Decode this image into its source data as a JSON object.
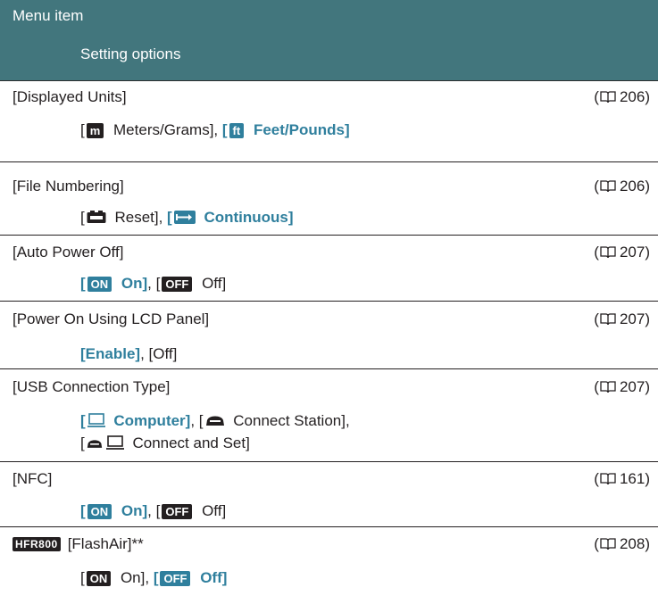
{
  "header": {
    "menu_item": "Menu item",
    "setting_options": "Setting options"
  },
  "rows": [
    {
      "name": "[Displayed Units]",
      "ref": "206",
      "opt_a_open": "[",
      "opt_a_badge": "m",
      "opt_a_text": " Meters/Grams], ",
      "opt_b_open": "[",
      "opt_b_badge": "ft",
      "opt_b_text": " Feet/Pounds]"
    },
    {
      "name": "[File Numbering]",
      "ref": "206",
      "opt_a_open": "[",
      "opt_a_text": " Reset], ",
      "opt_b_open": "[",
      "opt_b_text": " Continuous]"
    },
    {
      "name": "[Auto Power Off]",
      "ref": "207",
      "opt_a_open": "[",
      "opt_a_badge": "ON",
      "opt_a_text": " On]",
      "sep": ", ",
      "opt_b_open": "[",
      "opt_b_badge": "OFF",
      "opt_b_text": " Off]"
    },
    {
      "name": "[Power On Using LCD Panel]",
      "ref": "207",
      "opt_a": "[Enable]",
      "sep": ", ",
      "opt_b": "[Off]"
    },
    {
      "name": "[USB Connection Type]",
      "ref": "207",
      "opt_a_open": "[",
      "opt_a_text": " Computer]",
      "sep": ", ",
      "opt_b_open": "[",
      "opt_b_text": " Connect Station],",
      "opt_c_open": "[",
      "opt_c_text": " Connect and Set]"
    },
    {
      "name": "[NFC]",
      "ref": "161",
      "opt_a_open": "[",
      "opt_a_badge": "ON",
      "opt_a_text": " On]",
      "sep": ", ",
      "opt_b_open": "[",
      "opt_b_badge": "OFF",
      "opt_b_text": " Off]"
    },
    {
      "model_badge": "HFR800",
      "name": "[FlashAir]**",
      "ref": "208",
      "opt_a_open": "[",
      "opt_a_badge": "ON",
      "opt_a_text": " On], ",
      "opt_b_open": "[",
      "opt_b_badge": "OFF",
      "opt_b_text": " Off]"
    }
  ],
  "ref_open": "(",
  "ref_close": ")",
  "colors": {
    "header_bg": "#42767d",
    "highlight": "#2f7f9d",
    "text": "#231f20"
  },
  "icons": {
    "page_ref": "book-icon",
    "reset": "film-reset-icon",
    "continuous": "continuous-arrow-icon",
    "computer": "computer-icon",
    "station": "connect-station-icon"
  }
}
